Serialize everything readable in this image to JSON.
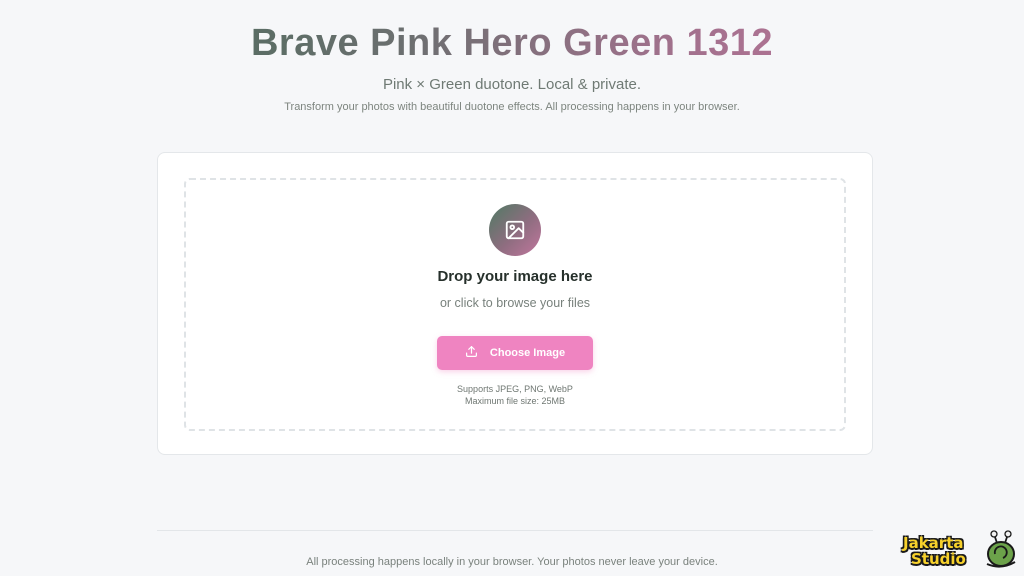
{
  "header": {
    "title": "Brave Pink Hero Green 1312",
    "subtitle": "Pink × Green duotone. Local & private.",
    "tagline": "Transform your photos with beautiful duotone effects. All processing happens in your browser."
  },
  "upload": {
    "icon": "image-icon",
    "heading": "Drop your image here",
    "subheading": "or click to browse your files",
    "button_icon": "upload-icon",
    "button_label": "Choose Image",
    "supported_formats": "Supports JPEG, PNG, WebP",
    "max_size": "Maximum file size: 25MB"
  },
  "footer": {
    "text": "All processing happens locally in your browser. Your photos never leave your device."
  },
  "watermark": {
    "line1": "Jakarta",
    "line2": "Studio"
  },
  "colors": {
    "accent_pink": "#ef84c1",
    "accent_green": "#3f6a53",
    "background": "#f6f7f9"
  }
}
